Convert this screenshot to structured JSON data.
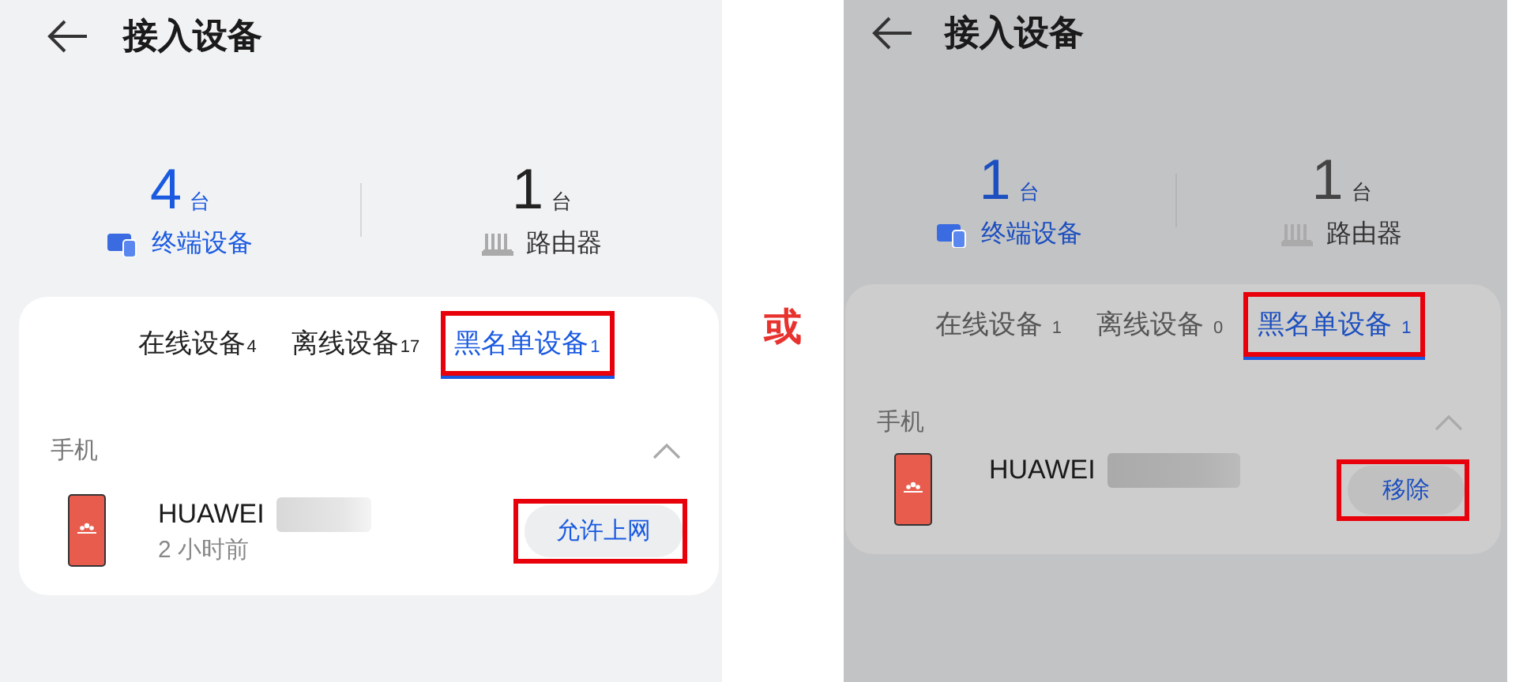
{
  "panels": [
    {
      "dimmed": false,
      "title": "接入设备",
      "stats": [
        {
          "kind": "terminal",
          "count": "4",
          "unit": "台",
          "label": "终端设备",
          "selected": true
        },
        {
          "kind": "router",
          "count": "1",
          "unit": "台",
          "label": "路由器",
          "selected": false
        }
      ],
      "tabs": [
        {
          "label": "在线设备",
          "count": "4",
          "selected": false,
          "highlighted": false
        },
        {
          "label": "离线设备",
          "count": "17",
          "selected": false,
          "highlighted": false
        },
        {
          "label": "黑名单设备",
          "count": "1",
          "selected": true,
          "highlighted": true
        }
      ],
      "section": {
        "title": "手机",
        "expanded": true
      },
      "device": {
        "name": "HUAWEI",
        "redacted": true,
        "time": "2 小时前",
        "action": "允许上网",
        "action_highlighted": true
      }
    },
    {
      "dimmed": true,
      "title": "接入设备",
      "stats": [
        {
          "kind": "terminal",
          "count": "1",
          "unit": "台",
          "label": "终端设备",
          "selected": true
        },
        {
          "kind": "router",
          "count": "1",
          "unit": "台",
          "label": "路由器",
          "selected": false
        }
      ],
      "tabs": [
        {
          "label": "在线设备",
          "count": "1",
          "selected": false,
          "highlighted": false
        },
        {
          "label": "离线设备",
          "count": "0",
          "selected": false,
          "highlighted": false
        },
        {
          "label": "黑名单设备",
          "count": "1",
          "selected": true,
          "highlighted": true
        }
      ],
      "section": {
        "title": "手机",
        "expanded": true
      },
      "device": {
        "name": "HUAWEI",
        "redacted": true,
        "action": "移除",
        "action_highlighted": true
      }
    }
  ],
  "separator": "或"
}
